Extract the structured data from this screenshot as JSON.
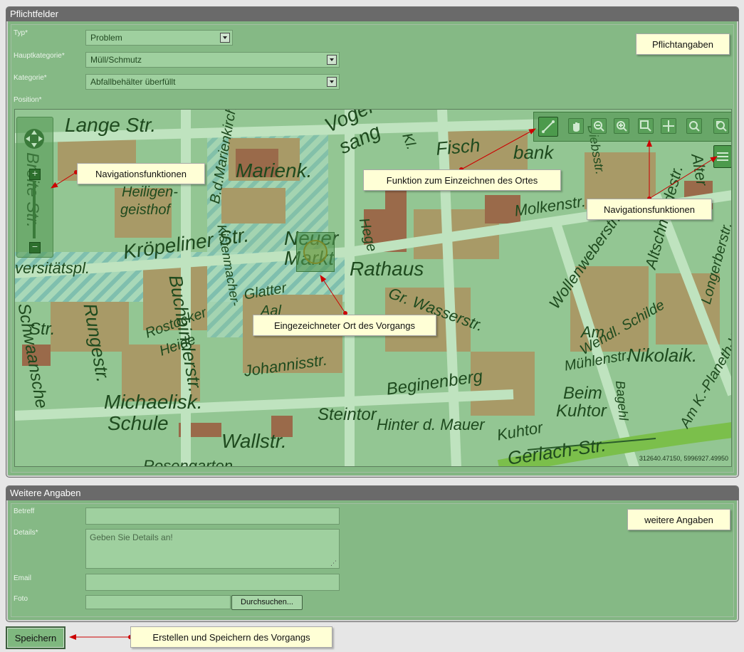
{
  "pflicht": {
    "header": "Pflichtfelder",
    "typ_label": "Typ*",
    "typ_value": "Problem",
    "haupt_label": "Hauptkategorie*",
    "haupt_value": "Müll/Schmutz",
    "kat_label": "Kategorie*",
    "kat_value": "Abfallbehälter überfüllt",
    "pos_label": "Position*",
    "note": "Pflichtangaben"
  },
  "map": {
    "coordinates": "312640.47150, 5996927.49950",
    "streets": [
      "Lange Str.",
      "Vogel-",
      "sang",
      "Fisch",
      "bank",
      "Marienk.",
      "B.d.Marienkirche",
      "Heiligen-",
      "geisthof",
      "Kröpeliner Str.",
      "Neuer",
      "Markt",
      "Rathaus",
      "Buchbinderstr.",
      "Rungestr.",
      "Rostocker",
      "Heide",
      "Glatter",
      "Aal",
      "Johannisstr.",
      "Schwaansche",
      "Str.",
      "Michaelisk.",
      "Schule",
      "Wallstr.",
      "Steintor",
      "Hinter d. Mauer",
      "Kuhtor",
      "Beginenberg",
      "Molkenstr.",
      "Wollenweberstr.",
      "Nikolaik.",
      "Mühlenstr.",
      "Beim",
      "Kuhtor",
      "Am",
      "Wendl. Schilde",
      "Gr. Wasserstr.",
      "Breite Str.",
      "versitätspl.",
      "Gerlach-Str.",
      "Rosengarten",
      "Kistenmacher-",
      "Hege",
      "Kl.",
      "Altschmiedestr.",
      "Longerberstr.",
      "Diebsstr.",
      "Alter",
      "Bagehl",
      "Am K.-Planeth-Weg"
    ],
    "toolbar_icons": [
      "draw-icon",
      "pan-icon",
      "zoom-out-icon",
      "zoom-in-icon",
      "zoom-box-icon",
      "move-icon",
      "zoom-extent-icon",
      "zoom-previous-icon"
    ]
  },
  "annotations": {
    "nav_left": "Navigationsfunktionen",
    "draw": "Funktion zum Einzeichnen des Ortes",
    "nav_right": "Navigationsfunktionen",
    "marker": "Eingezeichneter Ort des Vorgangs",
    "save": "Erstellen und Speichern des Vorgangs"
  },
  "weitere": {
    "header": "Weitere Angaben",
    "betreff_label": "Betreff",
    "details_label": "Details*",
    "details_placeholder": "Geben Sie Details an!",
    "email_label": "Email",
    "foto_label": "Foto",
    "browse_label": "Durchsuchen...",
    "note": "weitere Angaben"
  },
  "save_label": "Speichern",
  "colors": {
    "panel": "#82b582",
    "header": "#6a6a6a",
    "note": "#ffffd6",
    "arrow": "#cc0000"
  }
}
